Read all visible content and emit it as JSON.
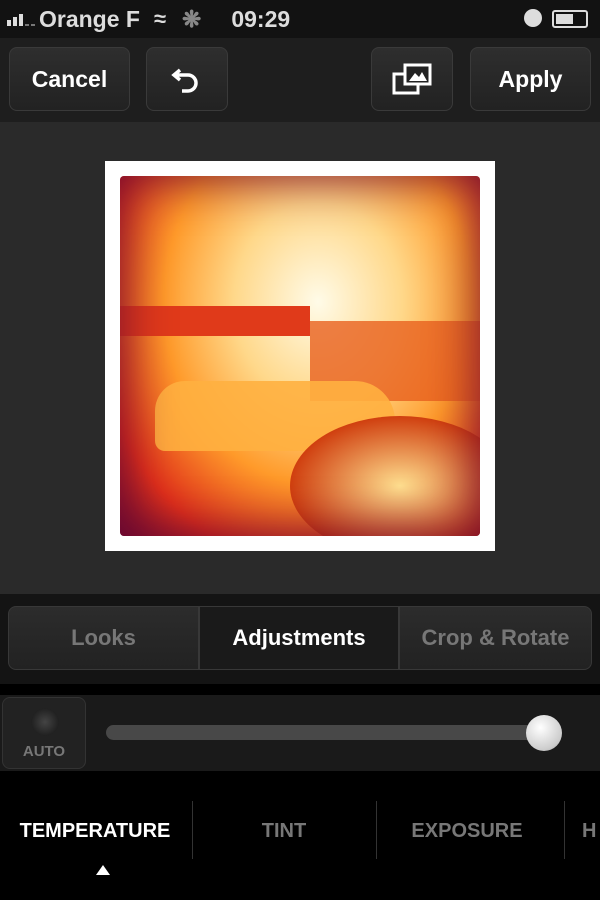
{
  "status": {
    "carrier": "Orange F",
    "time": "09:29",
    "signal_bars": 3,
    "battery_percent": 60
  },
  "toolbar": {
    "cancel": "Cancel",
    "undo_icon": "undo-icon",
    "compare_icon": "compare-images-icon",
    "apply": "Apply"
  },
  "tabs": [
    {
      "label": "Looks",
      "active": false
    },
    {
      "label": "Adjustments",
      "active": true
    },
    {
      "label": "Crop & Rotate",
      "active": false
    }
  ],
  "slider": {
    "auto_label": "AUTO",
    "value": 100,
    "min": 0,
    "max": 100
  },
  "params": [
    {
      "label": "TEMPERATURE",
      "active": true
    },
    {
      "label": "TINT"
    },
    {
      "label": "EXPOSURE"
    },
    {
      "label": "H"
    }
  ],
  "colors": {
    "toolbar": "#1e1e1e",
    "active_text": "#ffffff",
    "inactive_text": "#777777"
  }
}
